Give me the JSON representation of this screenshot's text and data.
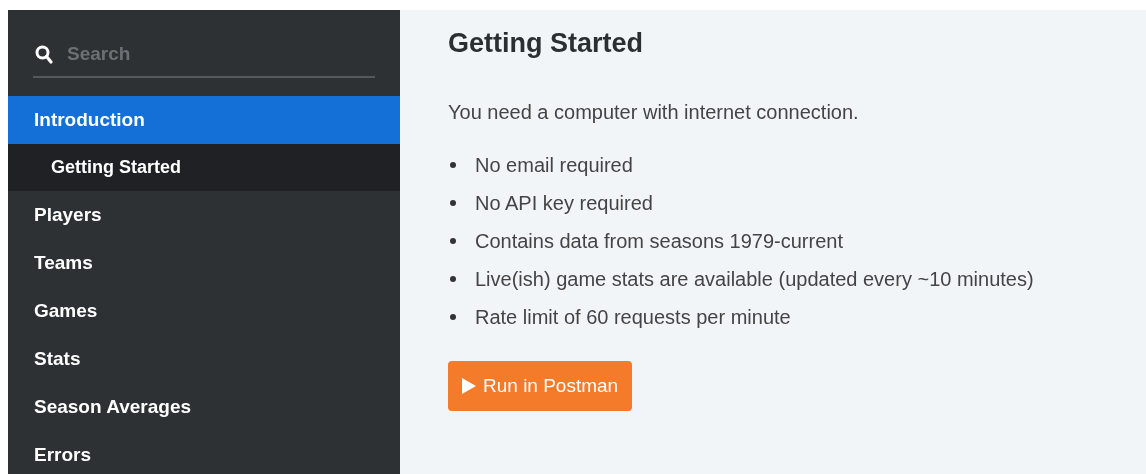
{
  "sidebar": {
    "search": {
      "placeholder": "Search"
    },
    "items": [
      {
        "label": "Introduction",
        "selected": true,
        "children": [
          {
            "label": "Getting Started",
            "selected": false
          }
        ]
      },
      {
        "label": "Players",
        "selected": false
      },
      {
        "label": "Teams",
        "selected": false
      },
      {
        "label": "Games",
        "selected": false
      },
      {
        "label": "Stats",
        "selected": false
      },
      {
        "label": "Season Averages",
        "selected": false
      },
      {
        "label": "Errors",
        "selected": false
      }
    ]
  },
  "content": {
    "heading": "Getting Started",
    "intro": "You need a computer with internet connection.",
    "bullets": [
      "No email required",
      "No API key required",
      "Contains data from seasons 1979-current",
      "Live(ish) game stats are available (updated every ~10 minutes)",
      "Rate limit of 60 requests per minute"
    ],
    "button": {
      "label": "Run in Postman"
    }
  }
}
